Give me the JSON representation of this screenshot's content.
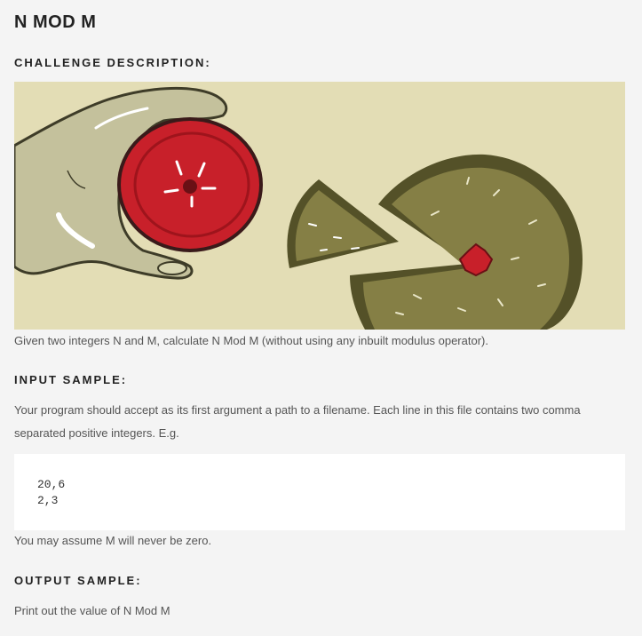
{
  "title": "N MOD M",
  "sections": {
    "description_heading": "CHALLENGE DESCRIPTION:",
    "description_text": "Given two integers N and M, calculate N Mod M (without using any inbuilt modulus operator).",
    "input_heading": "INPUT SAMPLE:",
    "input_text": "Your program should accept as its first argument a path to a filename. Each line in this file contains two comma separated positive integers. E.g.",
    "input_code": "20,6\n2,3",
    "assumption_text": "You may assume M will never be zero.",
    "output_heading": "OUTPUT SAMPLE:",
    "output_text": "Print out the value of N Mod M"
  },
  "colors": {
    "banner_background": "#e3ddb5",
    "fruit_red": "#c8202a",
    "citrus_green": "#857f45",
    "rind_dark": "#545128"
  }
}
